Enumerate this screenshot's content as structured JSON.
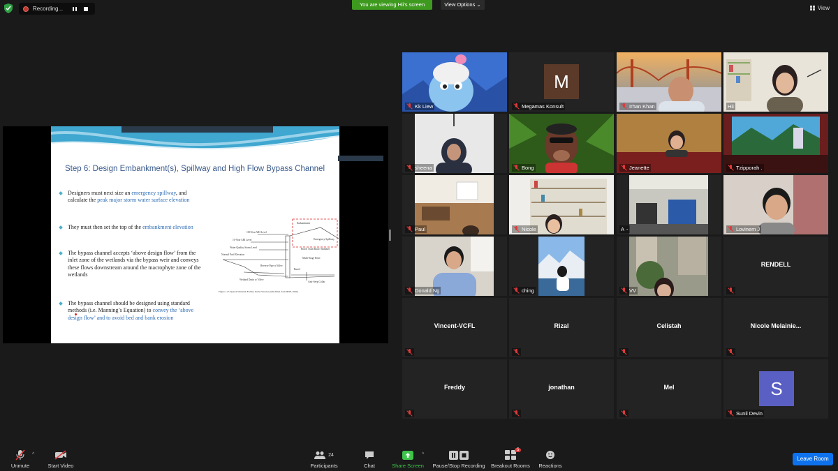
{
  "top": {
    "recording_label": "Recording...",
    "viewing_banner": "You are viewing Hii's screen",
    "view_options": "View Options",
    "view_label": "View"
  },
  "slide": {
    "title": "Step 6: Design Embankment(s), Spillway and High Flow Bypass Channel",
    "bullets": [
      {
        "parts": [
          "Designers must next size an ",
          "emergency spillway",
          ", and calculate the ",
          "peak major storm water surface elevation",
          ""
        ]
      },
      {
        "parts": [
          "They must then set the top of the ",
          "embankment elevation",
          ""
        ]
      },
      {
        "parts": [
          "The bypass channel accepts ‘above design flow’ from the inlet zone of the wetlands via the bypass weir and conveys these flows downstream around the macrophyte zone of the wetlands"
        ]
      },
      {
        "parts": [
          "The bypass channel should be designed using standard methods (i.e. Manning’s Equation) to ",
          "convey the ‘above design flow’ and to avoid bed and bank erosion",
          ""
        ]
      }
    ],
    "diagram_labels": {
      "embankment": "Embankment",
      "y100": "100 Year ARI Level",
      "emergency": "Emergency Spillway",
      "y10": "10-Year ARI Level",
      "wq": "Water Quality Storm Level",
      "hood": "Hood/ Trash Rack/ Skimmer",
      "multi": "Multi-Stage Riser",
      "pool": "Normal Pool Elevation",
      "reverse": "Reverse Pipe w/Valve",
      "barrel": "Barrel",
      "drain": "Wetland Drain w/ Valve",
      "seep": "Anti-Seep Collar",
      "caption": "Figure 11.5   Typical Wetlands Facility Outlet Structure (Modified from MDE, 2000)"
    }
  },
  "participants": [
    {
      "name": "Kk Liew",
      "kind": "video"
    },
    {
      "name": "Megamas Konsult",
      "kind": "avatar",
      "initial": "M",
      "color": "#5b3a2a"
    },
    {
      "name": "Irhan Khan",
      "kind": "video"
    },
    {
      "name": "Hii",
      "kind": "video",
      "active": true
    },
    {
      "name": "sheena",
      "kind": "video"
    },
    {
      "name": "Bong",
      "kind": "video"
    },
    {
      "name": "Jeanette",
      "kind": "video"
    },
    {
      "name": "Tzipporah .",
      "kind": "video"
    },
    {
      "name": "Paul",
      "kind": "video"
    },
    {
      "name": "Nicole",
      "kind": "video"
    },
    {
      "name": "A",
      "kind": "video"
    },
    {
      "name": "Lovinem J",
      "kind": "video"
    },
    {
      "name": "Donald Ng",
      "kind": "video"
    },
    {
      "name": "ching",
      "kind": "video"
    },
    {
      "name": "VV",
      "kind": "video"
    },
    {
      "name": "RENDELL",
      "kind": "name"
    },
    {
      "name": "Vincent-VCFL",
      "kind": "name"
    },
    {
      "name": "Rizal",
      "kind": "name"
    },
    {
      "name": "Celistah",
      "kind": "name"
    },
    {
      "name": "Nicole  Melainie...",
      "kind": "name"
    },
    {
      "name": "Freddy",
      "kind": "name"
    },
    {
      "name": "jonathan",
      "kind": "name"
    },
    {
      "name": "Mel",
      "kind": "name"
    },
    {
      "name": "Sunil Devin",
      "kind": "avatar",
      "initial": "S",
      "color": "#5a5fc4"
    }
  ],
  "toolbar": {
    "unmute": "Unmute",
    "start_video": "Start Video",
    "participants": "Participants",
    "participants_count": "24",
    "chat": "Chat",
    "share_screen": "Share Screen",
    "recording": "Pause/Stop Recording",
    "breakout": "Breakout Rooms",
    "breakout_badge": "5",
    "reactions": "Reactions",
    "leave": "Leave Room"
  },
  "colors": {
    "share_green": "#3e9a1f",
    "leave_blue": "#0e72ed",
    "muted_red": "#e03a3a",
    "active_border": "#c8d44a"
  }
}
